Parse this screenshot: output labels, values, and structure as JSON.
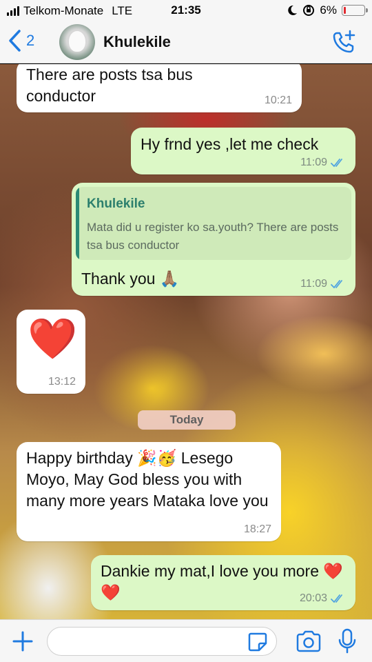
{
  "status_bar": {
    "carrier": "Telkom-Monate",
    "network": "LTE",
    "time": "21:35",
    "battery": "6%"
  },
  "header": {
    "back_count": "2",
    "contact_name": "Khulekile"
  },
  "messages": [
    {
      "direction": "in",
      "text": "There are posts tsa bus conductor",
      "time": "10:21"
    },
    {
      "direction": "out",
      "text": "Hy frnd yes ,let me check",
      "time": "11:09"
    },
    {
      "direction": "out",
      "reply_to_name": "Khulekile",
      "reply_to_text": "Mata did u register ko sa.youth? There are posts tsa bus conductor",
      "text": "Thank you 🙏🏽",
      "time": "11:09"
    },
    {
      "direction": "in",
      "text": "❤️",
      "time": "13:12"
    },
    {
      "direction": "in",
      "text": "Happy birthday 🎉🥳 Lesego Moyo, May God bless you with many more years Mataka love you",
      "time": "18:27"
    },
    {
      "direction": "out",
      "text": "Dankie my mat,I love you more ❤️❤️",
      "time": "20:03"
    }
  ],
  "date_divider": "Today",
  "input": {
    "placeholder": ""
  },
  "colors": {
    "accent": "#1f7ae0",
    "outgoing_bubble": "#dcf8c6",
    "incoming_bubble": "#ffffff",
    "read_ticks": "#4fa3e0"
  }
}
